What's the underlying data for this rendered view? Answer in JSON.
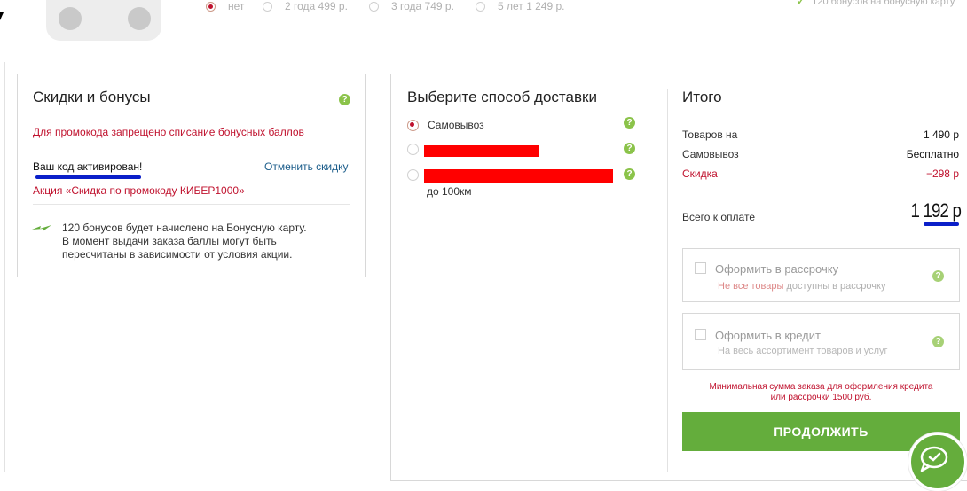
{
  "warranty": {
    "options": [
      {
        "label": "нет",
        "selected": true
      },
      {
        "label": "2 года 499  р.",
        "selected": false
      },
      {
        "label": "3 года 749  р.",
        "selected": false
      },
      {
        "label": "5 лет 1 249  р.",
        "selected": false
      }
    ],
    "top_right_note": "120 бонусов на бонусную карту"
  },
  "discounts": {
    "title": "Скидки и бонусы",
    "promo_warning": "Для промокода запрещено списание бонусных баллов",
    "code_activated": "Ваш код активирован!",
    "cancel_discount": "Отменить скидку",
    "promo_action": "Акция «Скидка по промокоду КИБЕР1000»",
    "bonus_line1": "120 бонусов будет начислено на Бонусную карту.",
    "bonus_line2": "В момент выдачи заказа баллы могут быть",
    "bonus_line3": "пересчитаны в зависимости от условия акции."
  },
  "delivery": {
    "title": "Выберите способ доставки",
    "options": [
      {
        "label": "Самовывоз",
        "selected": true
      },
      {
        "label": "",
        "selected": false,
        "redacted": true
      },
      {
        "label": "",
        "selected": false,
        "redacted": true,
        "sublabel": "до 100км"
      }
    ]
  },
  "summary": {
    "title": "Итого",
    "goods_label": "Товаров на",
    "goods_value": "1 490 р",
    "pickup_label": "Самовывоз",
    "pickup_value": "Бесплатно",
    "discount_label": "Скидка",
    "discount_value": "−298 р",
    "total_label": "Всего к оплате",
    "total_value": "1 192 р",
    "installment": {
      "label": "Оформить в рассрочку",
      "note_link": "Не все товары",
      "note_rest": " доступны в рассрочку"
    },
    "credit": {
      "label": "Оформить в кредит",
      "note": "На весь ассортимент товаров и услуг"
    },
    "min_sum_line1": "Минимальная сумма заказа для оформления кредита",
    "min_sum_line2": "или рассрочки 1500 руб.",
    "continue_button": "ПРОДОЛЖИТЬ"
  },
  "colors": {
    "accent_green": "#64ad3c",
    "help_green": "#8bc34a",
    "warning_red": "#c0122e",
    "redaction_red": "#ff0000",
    "underline_blue": "#0a1fc9",
    "link_blue": "#1a5c8a"
  }
}
